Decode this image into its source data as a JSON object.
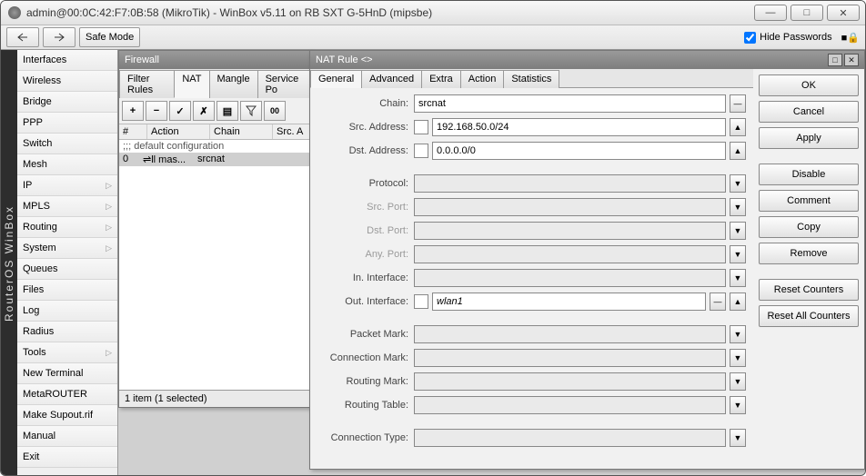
{
  "window": {
    "title": "admin@00:0C:42:F7:0B:58 (MikroTik) - WinBox v5.11 on RB SXT G-5HnD (mipsbe)"
  },
  "toolbar": {
    "safe_mode": "Safe Mode",
    "hide_passwords": "Hide Passwords"
  },
  "rail": "RouterOS WinBox",
  "sidebar": {
    "items": [
      {
        "label": "Interfaces",
        "sub": false
      },
      {
        "label": "Wireless",
        "sub": false
      },
      {
        "label": "Bridge",
        "sub": false
      },
      {
        "label": "PPP",
        "sub": false
      },
      {
        "label": "Switch",
        "sub": false
      },
      {
        "label": "Mesh",
        "sub": false
      },
      {
        "label": "IP",
        "sub": true
      },
      {
        "label": "MPLS",
        "sub": true
      },
      {
        "label": "Routing",
        "sub": true
      },
      {
        "label": "System",
        "sub": true
      },
      {
        "label": "Queues",
        "sub": false
      },
      {
        "label": "Files",
        "sub": false
      },
      {
        "label": "Log",
        "sub": false
      },
      {
        "label": "Radius",
        "sub": false
      },
      {
        "label": "Tools",
        "sub": true
      },
      {
        "label": "New Terminal",
        "sub": false
      },
      {
        "label": "MetaROUTER",
        "sub": false
      },
      {
        "label": "Make Supout.rif",
        "sub": false
      },
      {
        "label": "Manual",
        "sub": false
      },
      {
        "label": "Exit",
        "sub": false
      }
    ]
  },
  "firewall": {
    "title": "Firewall",
    "tabs": [
      "Filter Rules",
      "NAT",
      "Mangle",
      "Service Po"
    ],
    "active_tab": 1,
    "columns": {
      "num": "#",
      "action": "Action",
      "chain": "Chain",
      "srca": "Src. A"
    },
    "comment_row": ";;; default configuration",
    "row": {
      "num": "0",
      "action": "⇌ll mas...",
      "chain": "srcnat"
    },
    "status": "1 item (1 selected)"
  },
  "nat": {
    "title": "NAT Rule <>",
    "tabs": [
      "General",
      "Advanced",
      "Extra",
      "Action",
      "Statistics"
    ],
    "active_tab": 0,
    "fields": {
      "chain_label": "Chain:",
      "chain_value": "srcnat",
      "src_addr_label": "Src. Address:",
      "src_addr_value": "192.168.50.0/24",
      "dst_addr_label": "Dst. Address:",
      "dst_addr_value": "0.0.0.0/0",
      "protocol_label": "Protocol:",
      "src_port_label": "Src. Port:",
      "dst_port_label": "Dst. Port:",
      "any_port_label": "Any. Port:",
      "in_if_label": "In. Interface:",
      "out_if_label": "Out. Interface:",
      "out_if_value": "wlan1",
      "packet_mark_label": "Packet Mark:",
      "conn_mark_label": "Connection Mark:",
      "routing_mark_label": "Routing Mark:",
      "routing_table_label": "Routing Table:",
      "conn_type_label": "Connection Type:"
    },
    "buttons": {
      "ok": "OK",
      "cancel": "Cancel",
      "apply": "Apply",
      "disable": "Disable",
      "comment": "Comment",
      "copy": "Copy",
      "remove": "Remove",
      "reset_counters": "Reset Counters",
      "reset_all": "Reset All Counters"
    }
  }
}
